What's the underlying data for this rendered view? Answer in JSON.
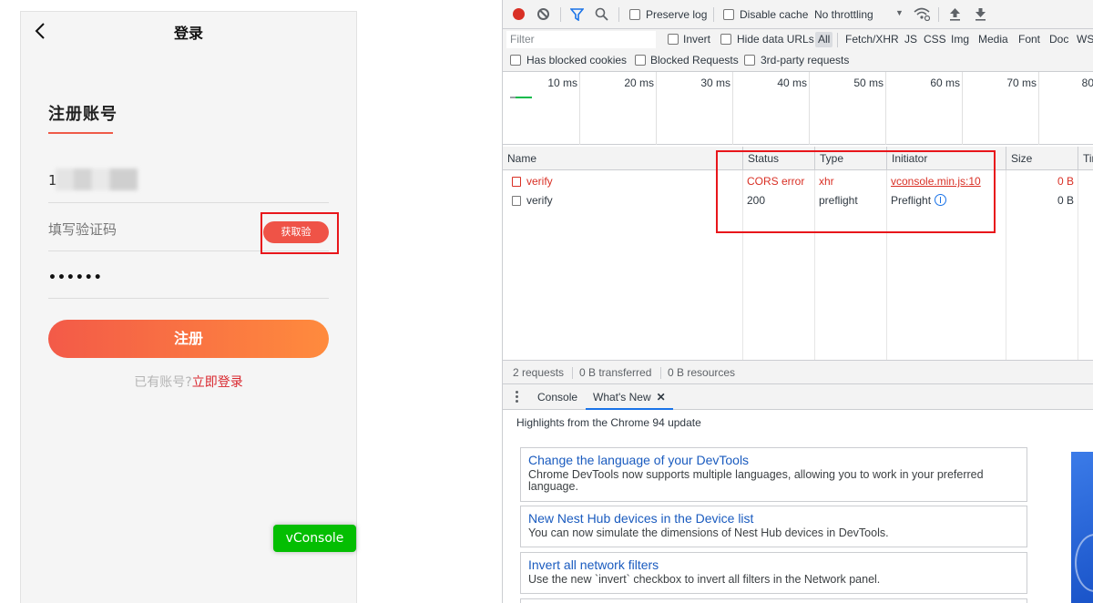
{
  "phone": {
    "title": "登录",
    "section_title": "注册账号",
    "phone_value": "1",
    "code_placeholder": "填写验证码",
    "get_code_label": "获取验",
    "password_value": "••••••",
    "register_label": "注册",
    "have_account": "已有账号?",
    "login_now": "立即登录",
    "vconsole_label": "vConsole"
  },
  "toolbar": {
    "preserve_log": "Preserve log",
    "disable_cache": "Disable cache",
    "throttling": "No throttling",
    "filter_placeholder": "Filter",
    "invert": "Invert",
    "hide_data_urls": "Hide data URLs",
    "types": [
      "All",
      "Fetch/XHR",
      "JS",
      "CSS",
      "Img",
      "Media",
      "Font",
      "Doc",
      "WS"
    ],
    "has_blocked_cookies": "Has blocked cookies",
    "blocked_requests": "Blocked Requests",
    "third_party": "3rd-party requests"
  },
  "timeline": {
    "ticks": [
      "10 ms",
      "20 ms",
      "30 ms",
      "40 ms",
      "50 ms",
      "60 ms",
      "70 ms",
      "80"
    ]
  },
  "grid": {
    "headers": {
      "name": "Name",
      "status": "Status",
      "type": "Type",
      "initiator": "Initiator",
      "size": "Size",
      "time": "Tir"
    },
    "rows": [
      {
        "name": "verify",
        "status": "CORS error",
        "type": "xhr",
        "initiator": "vconsole.min.js:10",
        "size": "0 B"
      },
      {
        "name": "verify",
        "status": "200",
        "type": "preflight",
        "initiator": "Preflight",
        "size": "0 B"
      }
    ]
  },
  "status_bar": {
    "requests": "2 requests",
    "transferred": "0 B transferred",
    "resources": "0 B resources"
  },
  "drawer": {
    "tabs": [
      "Console",
      "What's New"
    ],
    "highlights": "Highlights from the Chrome 94 update",
    "cards": [
      {
        "title": "Change the language of your DevTools",
        "desc": "Chrome DevTools now supports multiple languages, allowing you to work in your preferred language."
      },
      {
        "title": "New Nest Hub devices in the Device list",
        "desc": "You can now simulate the dimensions of Nest Hub devices in DevTools."
      },
      {
        "title": "Invert all network filters",
        "desc": "Use the new `invert` checkbox to invert all filters in the Network panel."
      }
    ]
  },
  "colors": {
    "accent_red": "#ef5347",
    "gradient_start": "#f35a48",
    "gradient_end": "#ff8b3d",
    "vconsole_green": "#04be02",
    "error_red": "#d93025",
    "link_blue": "#1a5bbf",
    "annotation_red": "#e8161b"
  },
  "icons": [
    "back-icon",
    "record-icon",
    "clear-icon",
    "filter-icon",
    "search-icon",
    "wifi-icon",
    "upload-icon",
    "download-icon",
    "document-icon",
    "preflight-icon",
    "close-icon",
    "kebab-icon"
  ]
}
